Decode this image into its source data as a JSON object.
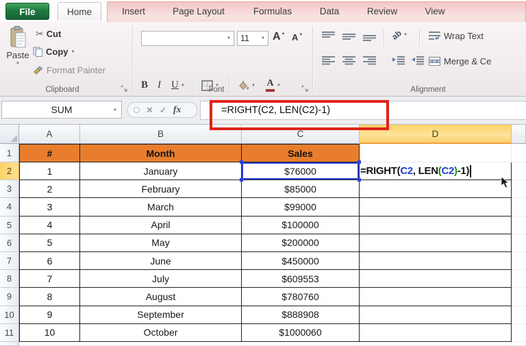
{
  "ribbon": {
    "tabs": [
      "File",
      "Home",
      "Insert",
      "Page Layout",
      "Formulas",
      "Data",
      "Review",
      "View"
    ],
    "active_tab": "Home",
    "clipboard": {
      "group_label": "Clipboard",
      "paste_label": "Paste",
      "cut_label": "Cut",
      "copy_label": "Copy",
      "format_painter_label": "Format Painter"
    },
    "font": {
      "group_label": "Font",
      "font_name_value": "",
      "font_size": "11",
      "bold_label": "B",
      "italic_label": "I",
      "underline_label": "U",
      "grow_font_label": "A",
      "shrink_font_label": "A",
      "font_color_label": "A"
    },
    "alignment": {
      "group_label": "Alignment",
      "orientation_label": "ab",
      "wrap_text_label": "Wrap Text",
      "merge_center_label": "Merge & Ce"
    }
  },
  "formula_bar": {
    "name_box_value": "SUM",
    "formula": "=RIGHT(C2, LEN(C2)-1)",
    "fx_label": "fx"
  },
  "icons": {
    "dropdown": "▼",
    "up_triangle": "▲",
    "down_triangle": "▼",
    "scissors": "✂",
    "check": "✓",
    "cancel": "✕"
  },
  "sheet": {
    "columns": [
      "A",
      "B",
      "C",
      "D"
    ],
    "selected_column": "D",
    "selected_row": 2,
    "header_row_number": "1",
    "header_cells": {
      "num": "#",
      "month": "Month",
      "sales": "Sales"
    },
    "rows": [
      {
        "row": "2",
        "num": "1",
        "month": "January",
        "sales": "$76000"
      },
      {
        "row": "3",
        "num": "2",
        "month": "February",
        "sales": "$85000"
      },
      {
        "row": "4",
        "num": "3",
        "month": "March",
        "sales": "$99000"
      },
      {
        "row": "5",
        "num": "4",
        "month": "April",
        "sales": "$100000"
      },
      {
        "row": "6",
        "num": "5",
        "month": "May",
        "sales": "$200000"
      },
      {
        "row": "7",
        "num": "6",
        "month": "June",
        "sales": "$450000"
      },
      {
        "row": "8",
        "num": "7",
        "month": "July",
        "sales": "$609553"
      },
      {
        "row": "9",
        "num": "8",
        "month": "August",
        "sales": "$780760"
      },
      {
        "row": "10",
        "num": "9",
        "month": "September",
        "sales": "$888908"
      },
      {
        "row": "11",
        "num": "10",
        "month": "October",
        "sales": "$1000060"
      }
    ],
    "active_cell": "D2",
    "d2_formula_parts": [
      {
        "text": "=RIGHT(",
        "color": "black"
      },
      {
        "text": "C2",
        "color": "blue"
      },
      {
        "text": ", LEN",
        "color": "black"
      },
      {
        "text": "(",
        "color": "green"
      },
      {
        "text": "C2",
        "color": "blue"
      },
      {
        "text": ")",
        "color": "green"
      },
      {
        "text": "-1)",
        "color": "black"
      }
    ]
  },
  "colors": {
    "header_fill_orange": "#E87E2D",
    "selected_header_yellow": "#FBD76E",
    "annotation_red": "#DF2318",
    "reference_blue": "#2140CE",
    "nested_paren_green": "#148A14",
    "file_tab_green": "#23833F"
  }
}
